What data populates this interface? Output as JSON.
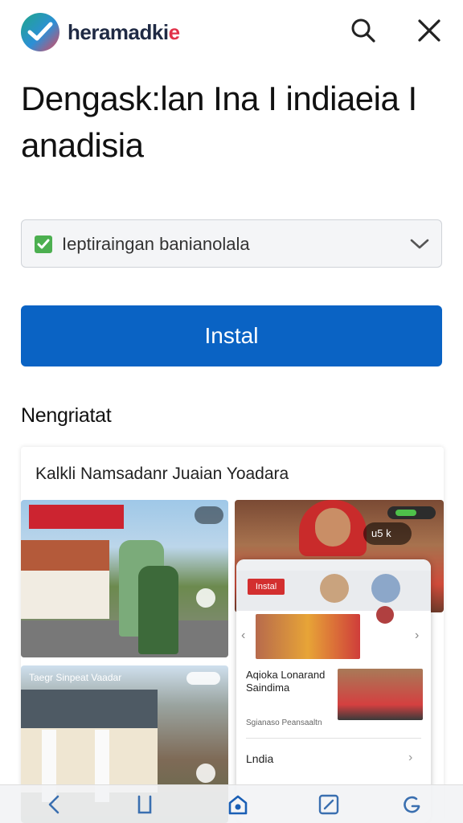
{
  "header": {
    "brand_main": "heramadki",
    "brand_accent": "e",
    "logo_icon": "checkmark-logo-icon",
    "search_icon": "search-icon",
    "close_icon": "close-icon"
  },
  "title": "Dengask:lan Ina I indiaeia I anadisia",
  "select": {
    "value": "Ieptiraingan banianolala",
    "check_icon": "green-check-icon",
    "chevron_icon": "chevron-down-icon"
  },
  "install_label": "Instal",
  "section_title": "Nengriatat",
  "card": {
    "title": "Kalkli Namsadanr Juaian Yoadara",
    "photo2_label": "Taegr Sinpeat Vaadar",
    "photo3_pill": "u5 k",
    "phone": {
      "button_label": "Instal",
      "heading": "Aqioka Lonarand Saindima",
      "subtext": "Sgianaso Peansaaltn",
      "list_item": "Lndia"
    }
  },
  "navbar": {
    "icons": [
      "back-icon",
      "recents-icon",
      "home-icon",
      "edit-icon",
      "refresh-icon"
    ]
  },
  "colors": {
    "primary": "#0a63c4",
    "accent_red": "#e1324a",
    "check_green": "#4caf50"
  }
}
